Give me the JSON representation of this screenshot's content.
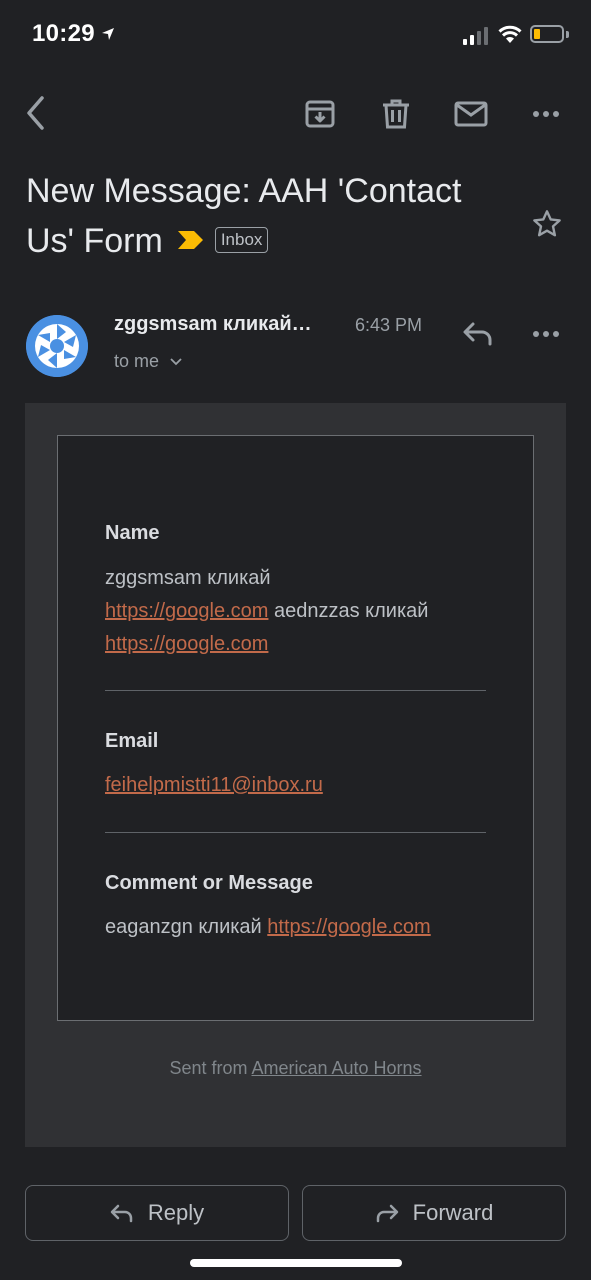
{
  "status_bar": {
    "time": "10:29"
  },
  "toolbar": {
    "back_icon": "chevron-left-icon",
    "archive_icon": "archive-icon",
    "delete_icon": "trash-icon",
    "mark_unread_icon": "mail-icon",
    "more_icon": "more-horizontal-icon"
  },
  "subject": {
    "text": "New Message: AAH 'Contact Us' Form",
    "label_chip": "Inbox"
  },
  "message": {
    "sender": "zggsmsam кликай…",
    "time": "6:43 PM",
    "recipient": "to me",
    "fields": {
      "name_label": "Name",
      "name_t1": "zggsmsam кликай",
      "name_link1": "https://google.com",
      "name_t2": " aednzzas кликай",
      "name_link2": "https://google.com",
      "email_label": "Email",
      "email_value": "feihelpmistti11@inbox.ru",
      "comment_label": "Comment or Message",
      "comment_t1": "eaganzgn кликай ",
      "comment_link": "https://google.com"
    },
    "footer_prefix": "Sent from ",
    "footer_link": "American Auto Horns"
  },
  "actions": {
    "reply": "Reply",
    "forward": "Forward"
  },
  "colors": {
    "background": "#202124",
    "link": "#c26a4a",
    "important_marker": "#fbbc04",
    "avatar": "#4a90e2"
  }
}
